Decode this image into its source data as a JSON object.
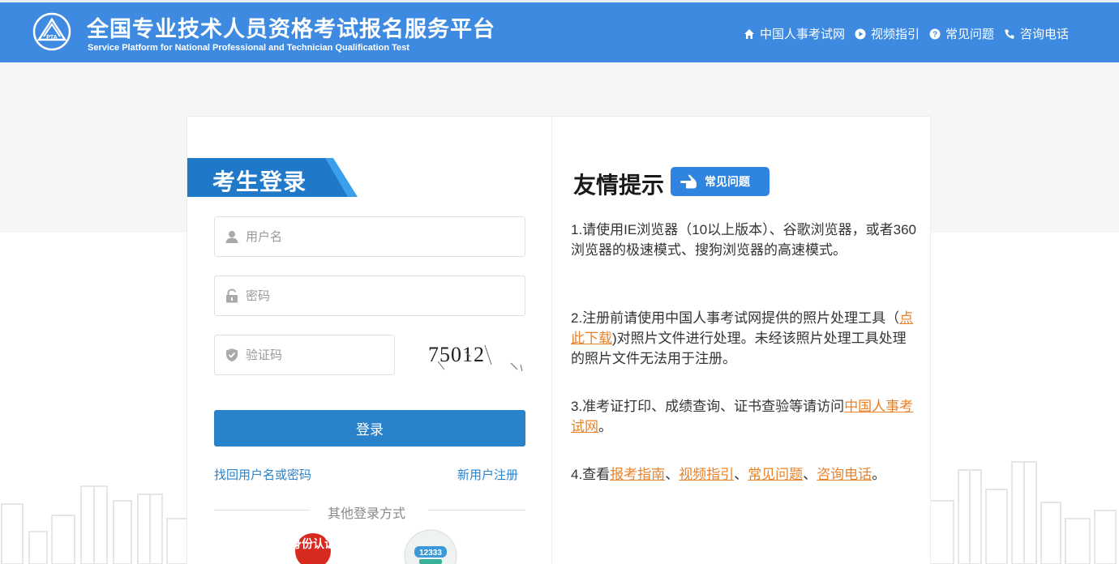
{
  "header": {
    "title_cn": "全国专业技术人员资格考试报名服务平台",
    "title_en": "Service Platform for National Professional and Technician Qualification Test",
    "logo_text": "PTA",
    "nav": [
      {
        "label": "中国人事考试网",
        "icon": "home-icon"
      },
      {
        "label": "视频指引",
        "icon": "play-icon"
      },
      {
        "label": "常见问题",
        "icon": "question-icon"
      },
      {
        "label": "咨询电话",
        "icon": "phone-icon"
      }
    ]
  },
  "login": {
    "heading": "考生登录",
    "username_placeholder": "用户名",
    "password_placeholder": "密码",
    "captcha_placeholder": "验证码",
    "captcha_text": "75012",
    "submit_label": "登录",
    "forgot_label": "找回用户名或密码",
    "register_label": "新用户注册",
    "other_methods_label": "其他登录方式",
    "alt_methods": [
      "身份认证",
      "12333"
    ]
  },
  "tips": {
    "title": "友情提示",
    "faq_badge": "常见问题",
    "items": {
      "t1": "1.请使用IE浏览器（10以上版本）、谷歌浏览器，或者360浏览器的极速模式、搜狗浏览器的高速模式。",
      "t2_a": "2.注册前请使用中国人事考试网提供的照片处理工具（",
      "t2_link": "点此下载",
      "t2_b": ")对照片文件进行处理。未经该照片处理工具处理的照片文件无法用于注册。",
      "t3_a": "3.准考证打印、成绩查询、证书查验等请访问",
      "t3_link": "中国人事考试网",
      "t3_b": "。",
      "t4_a": "4.查看",
      "t4_link1": "报考指南",
      "t4_sep1": "、",
      "t4_link2": "视频指引",
      "t4_sep2": "、",
      "t4_link3": "常见问题",
      "t4_sep3": "、",
      "t4_link4": "咨询电话",
      "t4_b": "。"
    }
  },
  "colors": {
    "header_bg": "#3d8ae0",
    "primary": "#2a82cb",
    "link_orange": "#e8822a"
  }
}
